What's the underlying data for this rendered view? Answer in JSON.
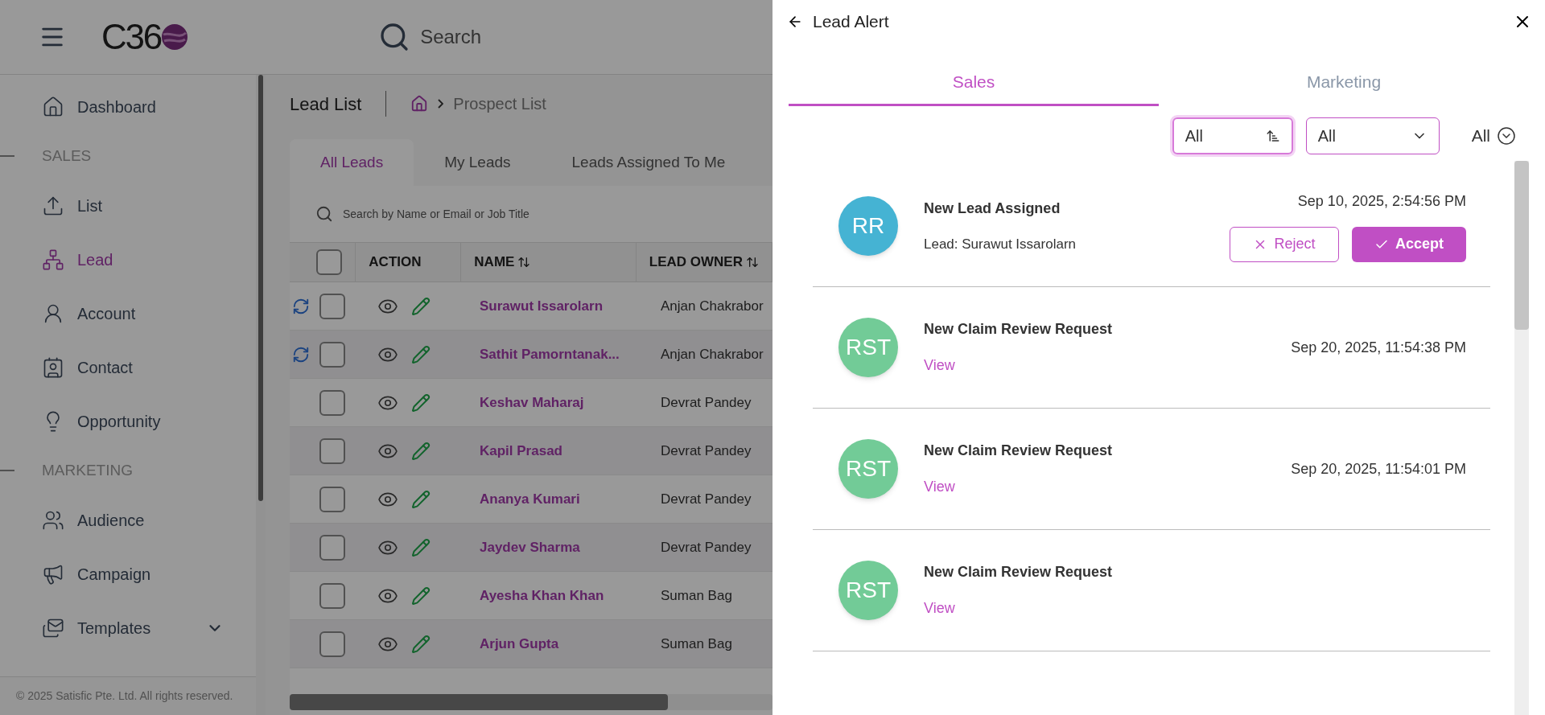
{
  "header": {
    "logo_text": "C36",
    "search_placeholder": "Search"
  },
  "sidebar": {
    "top_items": [
      {
        "label": "Dashboard",
        "selected": false
      }
    ],
    "sections": [
      {
        "title": "SALES",
        "items": [
          {
            "label": "List",
            "selected": false
          },
          {
            "label": "Lead",
            "selected": true
          },
          {
            "label": "Account",
            "selected": false
          },
          {
            "label": "Contact",
            "selected": false
          },
          {
            "label": "Opportunity",
            "selected": false
          }
        ]
      },
      {
        "title": "MARKETING",
        "items": [
          {
            "label": "Audience",
            "selected": false
          },
          {
            "label": "Campaign",
            "selected": false
          },
          {
            "label": "Templates",
            "selected": false,
            "expanded": false
          }
        ]
      }
    ],
    "footer": "© 2025 Satisfic Pte. Ltd. All rights reserved."
  },
  "page": {
    "title": "Lead List",
    "breadcrumb": "Prospect List",
    "tabs": [
      {
        "label": "All Leads",
        "selected": true
      },
      {
        "label": "My Leads",
        "selected": false
      },
      {
        "label": "Leads Assigned To Me",
        "selected": false
      }
    ],
    "search_placeholder": "Search by Name or Email or Job Title",
    "table": {
      "select_all_checked": false,
      "columns": [
        {
          "label": "ACTION",
          "sortable": false
        },
        {
          "label": "NAME",
          "sortable": true
        },
        {
          "label": "LEAD OWNER",
          "sortable": true
        }
      ],
      "rows": [
        {
          "name": "Surawut Issarolarn",
          "owner": "Anjan Chakrabor",
          "flagged": true,
          "checked": false
        },
        {
          "name": "Sathit Pamorntanak...",
          "owner": "Anjan Chakrabor",
          "flagged": true,
          "checked": false
        },
        {
          "name": "Keshav Maharaj",
          "owner": "Devrat Pandey",
          "flagged": false,
          "checked": false
        },
        {
          "name": "Kapil Prasad",
          "owner": "Devrat Pandey",
          "flagged": false,
          "checked": false
        },
        {
          "name": "Ananya Kumari",
          "owner": "Devrat Pandey",
          "flagged": false,
          "checked": false
        },
        {
          "name": "Jaydev Sharma",
          "owner": "Devrat Pandey",
          "flagged": false,
          "checked": false
        },
        {
          "name": "Ayesha Khan Khan",
          "owner": "Suman Bag",
          "flagged": false,
          "checked": false
        },
        {
          "name": "Arjun Gupta",
          "owner": "Suman Bag",
          "flagged": false,
          "checked": false
        }
      ]
    }
  },
  "drawer": {
    "title": "Lead Alert",
    "tabs": [
      {
        "label": "Sales",
        "selected": true
      },
      {
        "label": "Marketing",
        "selected": false
      }
    ],
    "filters": [
      {
        "kind": "sort",
        "value": "All"
      },
      {
        "kind": "dropdown",
        "value": "All"
      },
      {
        "kind": "toggle",
        "value": "All"
      }
    ],
    "alerts": [
      {
        "kind": "assignment",
        "initials": "RR",
        "color": "#45b3d3",
        "title": "New Lead Assigned",
        "detail": "Lead: Surawut Issarolarn",
        "time": "Sep 10, 2025, 2:54:56 PM",
        "reject": "Reject",
        "accept": "Accept"
      },
      {
        "kind": "review",
        "initials": "RST",
        "color": "#72cb97",
        "title": "New Claim Review Request",
        "link": "View",
        "time": "Sep 20, 2025, 11:54:38 PM"
      },
      {
        "kind": "review",
        "initials": "RST",
        "color": "#72cb97",
        "title": "New Claim Review Request",
        "link": "View",
        "time": "Sep 20, 2025, 11:54:01 PM"
      },
      {
        "kind": "review",
        "initials": "RST",
        "color": "#72cb97",
        "title": "New Claim Review Request",
        "link": "View"
      }
    ]
  }
}
